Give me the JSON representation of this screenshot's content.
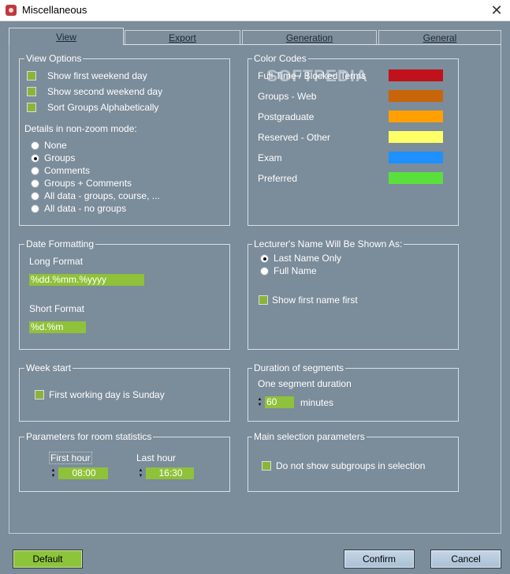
{
  "window": {
    "title": "Miscellaneous",
    "close_glyph": "✕"
  },
  "tabs": [
    {
      "label": "View"
    },
    {
      "label": "Export"
    },
    {
      "label": "Generation"
    },
    {
      "label": "General"
    }
  ],
  "view_options": {
    "legend": "View Options",
    "checkboxes": [
      {
        "label": "Show first weekend day",
        "checked": true
      },
      {
        "label": "Show second weekend day",
        "checked": true
      },
      {
        "label": "Sort Groups Alphabetically",
        "checked": true
      }
    ],
    "details_label": "Details in non-zoom mode:",
    "radios": [
      {
        "label": "None",
        "selected": false
      },
      {
        "label": "Groups",
        "selected": true
      },
      {
        "label": "Comments",
        "selected": false
      },
      {
        "label": "Groups + Comments",
        "selected": false
      },
      {
        "label": "All data - groups, course, ...",
        "selected": false
      },
      {
        "label": "All data - no groups",
        "selected": false
      }
    ]
  },
  "color_codes": {
    "legend": "Color Codes",
    "items": [
      {
        "label": "Full Time / Blocked Terms",
        "color": "#c1121c"
      },
      {
        "label": "Groups - Web",
        "color": "#c8650a"
      },
      {
        "label": "Postgraduate",
        "color": "#ffa000"
      },
      {
        "label": "Reserved - Other",
        "color": "#ffff66"
      },
      {
        "label": "Exam",
        "color": "#1e90ff"
      },
      {
        "label": "Preferred",
        "color": "#5ae03c"
      }
    ]
  },
  "date_formatting": {
    "legend": "Date Formatting",
    "long_label": "Long Format",
    "long_value": "%dd.%mm.%yyyy",
    "short_label": "Short Format",
    "short_value": "%d.%m"
  },
  "lecturer_name": {
    "legend": "Lecturer's Name Will Be Shown As:",
    "radios": [
      {
        "label": "Last Name Only",
        "selected": true
      },
      {
        "label": "Full Name",
        "selected": false
      }
    ],
    "checkbox": {
      "label": "Show first name first",
      "checked": true
    }
  },
  "week_start": {
    "legend": "Week start",
    "checkbox": {
      "label": "First working day is Sunday",
      "checked": true
    }
  },
  "duration": {
    "legend": "Duration of segments",
    "label": "One segment duration",
    "value": "60",
    "unit": "minutes"
  },
  "room_stats": {
    "legend": "Parameters for room statistics",
    "first_label": "First hour",
    "first_value": "08:00",
    "last_label": "Last hour",
    "last_value": "16:30"
  },
  "main_selection": {
    "legend": "Main selection parameters",
    "checkbox": {
      "label": "Do not show subgroups in selection",
      "checked": true
    }
  },
  "buttons": {
    "default": "Default",
    "confirm": "Confirm",
    "cancel": "Cancel"
  },
  "watermark": "SOFTPEDIA"
}
